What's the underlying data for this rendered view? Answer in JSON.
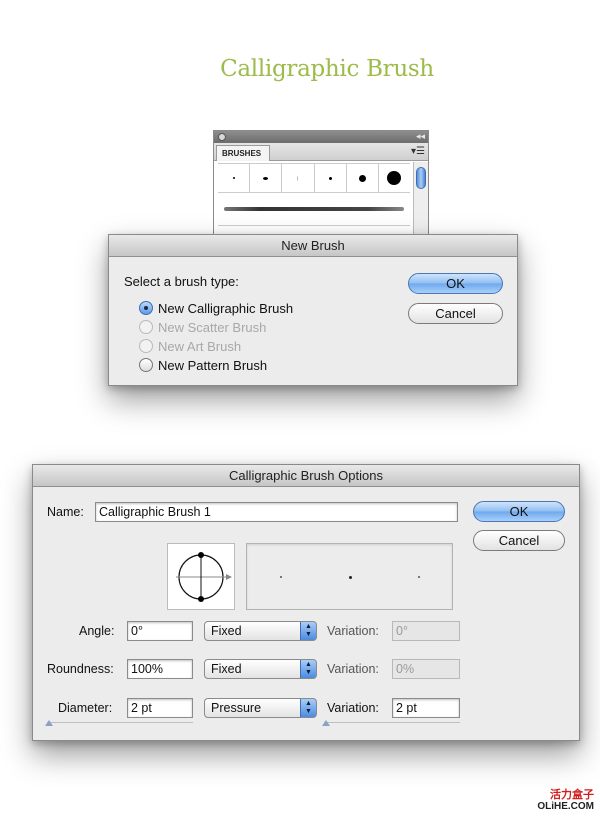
{
  "heading": "Calligraphic Brush",
  "brushes_panel": {
    "tab_label": "BRUSHES",
    "menu_icon": "panel-menu-icon",
    "collapse_glyph": "◂◂",
    "brush_dot_sizes": [
      1,
      3,
      1,
      3,
      7,
      13
    ]
  },
  "new_brush_dialog": {
    "title": "New Brush",
    "prompt": "Select a brush type:",
    "options": [
      {
        "label": "New Calligraphic Brush",
        "checked": true,
        "enabled": true
      },
      {
        "label": "New Scatter Brush",
        "checked": false,
        "enabled": false
      },
      {
        "label": "New Art Brush",
        "checked": false,
        "enabled": false
      },
      {
        "label": "New Pattern Brush",
        "checked": false,
        "enabled": true
      }
    ],
    "ok_label": "OK",
    "cancel_label": "Cancel"
  },
  "options_dialog": {
    "title": "Calligraphic Brush Options",
    "name_label": "Name:",
    "name_value": "Calligraphic Brush 1",
    "ok_label": "OK",
    "cancel_label": "Cancel",
    "rows": [
      {
        "label": "Angle:",
        "value": "0°",
        "mode": "Fixed",
        "variation_label": "Variation:",
        "variation_value": "0°",
        "variation_enabled": false
      },
      {
        "label": "Roundness:",
        "value": "100%",
        "mode": "Fixed",
        "variation_label": "Variation:",
        "variation_value": "0%",
        "variation_enabled": false
      },
      {
        "label": "Diameter:",
        "value": "2 pt",
        "mode": "Pressure",
        "variation_label": "Variation:",
        "variation_value": "2 pt",
        "variation_enabled": true
      }
    ]
  },
  "watermark": {
    "chinese": "活力盒子",
    "site": "OLiHE.COM"
  },
  "colors": {
    "heading": "#9dbb4a",
    "accent_blue": "#6ea8ec",
    "watermark_red": "#d21e1e"
  }
}
